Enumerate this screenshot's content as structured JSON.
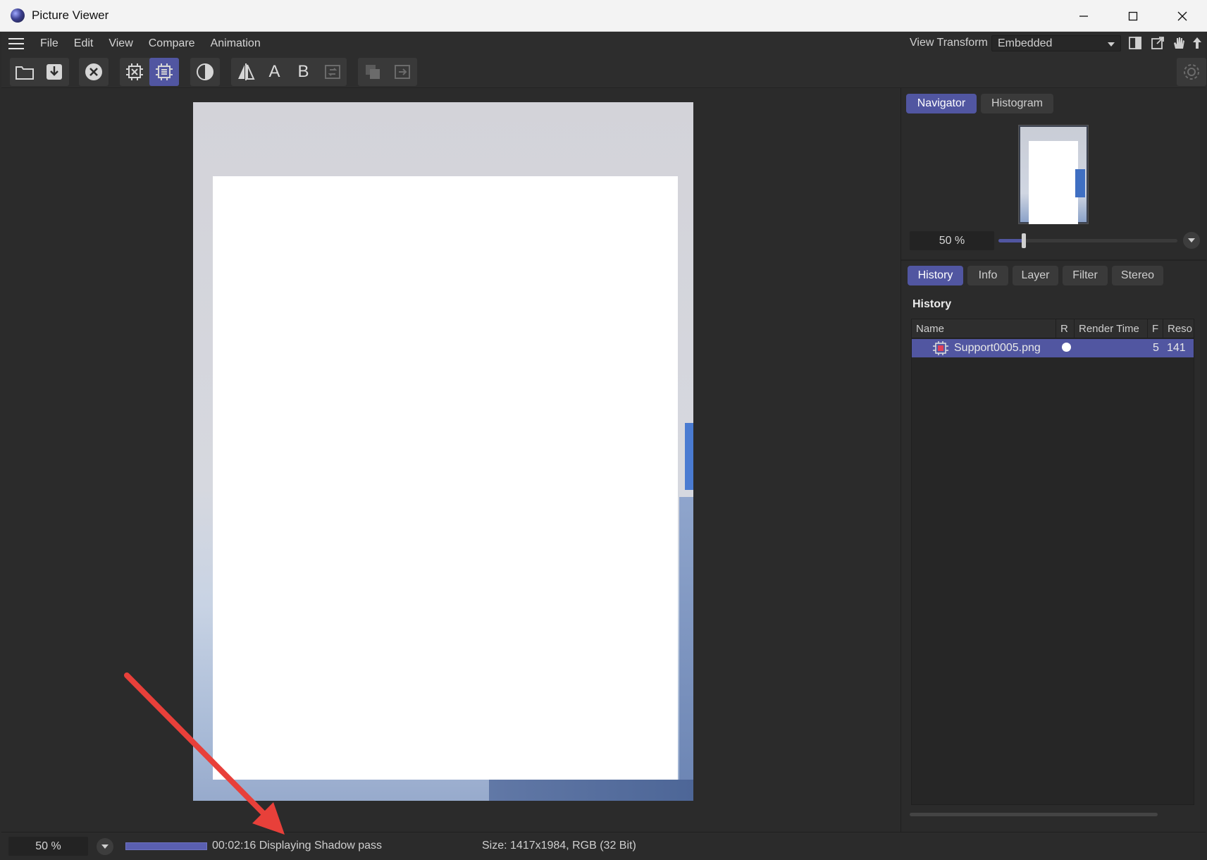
{
  "window": {
    "title": "Picture Viewer"
  },
  "menu": {
    "items": [
      "File",
      "Edit",
      "View",
      "Compare",
      "Animation"
    ]
  },
  "view_transform": {
    "label": "View Transform",
    "value": "Embedded"
  },
  "toolbar": {
    "letter_a": "A",
    "letter_b": "B"
  },
  "navigator": {
    "tabs": [
      "Navigator",
      "Histogram"
    ],
    "active_tab": "Navigator",
    "zoom": "50 %",
    "zoom_slider_fraction": 0.14
  },
  "panel_tabs": {
    "tabs": [
      "History",
      "Info",
      "Layer",
      "Filter",
      "Stereo"
    ],
    "active_tab": "History"
  },
  "history": {
    "title": "History",
    "columns": [
      "Name",
      "R",
      "Render Time",
      "F",
      "Reso"
    ],
    "rows": [
      {
        "name": "Support0005.png",
        "r": "●",
        "render_time": "",
        "f": "5",
        "reso": "141"
      }
    ]
  },
  "status": {
    "zoom": "50 %",
    "progress_fraction": 1.0,
    "message": "00:02:16 Displaying Shadow pass",
    "size_info": "Size: 1417x1984, RGB (32 Bit)"
  },
  "colors": {
    "accent": "#5156a1",
    "annotation_arrow": "#e8403a"
  },
  "icons": {
    "menu": "hamburger-icon",
    "open": "folder-open-icon",
    "save": "save-download-icon",
    "close": "close-circle-icon",
    "render_region": "render-region-icon",
    "render_active": "render-active-icon",
    "contrast": "contrast-icon",
    "compare": "compare-icon",
    "annotation": "red-arrow-annotation"
  }
}
